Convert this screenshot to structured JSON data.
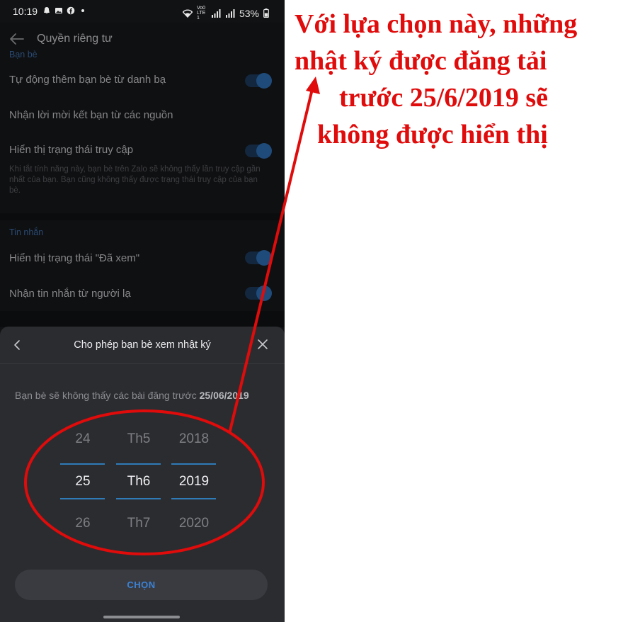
{
  "status_bar": {
    "time": "10:19",
    "network": "Vo0 LTE1",
    "battery": "53%"
  },
  "header": {
    "title": "Quyền riêng tư"
  },
  "friends_section": {
    "label": "Bạn bè",
    "rows": [
      {
        "label": "Tự động thêm bạn bè từ danh bạ",
        "toggle": "on"
      },
      {
        "label": "Nhận lời mời kết bạn từ các nguồn",
        "toggle": "none"
      },
      {
        "label": "Hiển thị trạng thái truy cập",
        "toggle": "on"
      }
    ],
    "access_desc": "Khi tắt tính năng này, bạn bè trên Zalo sẽ không thấy lần truy cập gần nhất của bạn. Bạn cũng không thấy được trạng thái truy cập của bạn bè."
  },
  "messages_section": {
    "label": "Tin nhắn",
    "rows": [
      {
        "label": "Hiển thị trạng thái \"Đã xem\"",
        "toggle": "on"
      },
      {
        "label": "Nhận tin nhắn từ người lạ",
        "toggle": "on"
      }
    ]
  },
  "sheet": {
    "title": "Cho phép bạn bè xem nhật ký",
    "desc_prefix": "Bạn bè sẽ không thấy các bài đăng trước",
    "desc_date": "25/06/2019",
    "confirm_label": "CHỌN"
  },
  "picker": {
    "day": {
      "prev": "24",
      "selected": "25",
      "next": "26"
    },
    "month": {
      "prev": "Th5",
      "selected": "Th6",
      "next": "Th7"
    },
    "year": {
      "prev": "2018",
      "selected": "2019",
      "next": "2020"
    }
  },
  "annotation": {
    "lines": [
      "Với lựa chọn này, những",
      "nhật ký được đăng tải",
      "trước 25/6/2019 sẽ",
      "không được hiển thị"
    ],
    "color": "#e00b0b"
  },
  "colors": {
    "accent": "#2f7bb8",
    "toggle_on": "#2f6fb6",
    "sheet_bg": "#2b2c30"
  }
}
